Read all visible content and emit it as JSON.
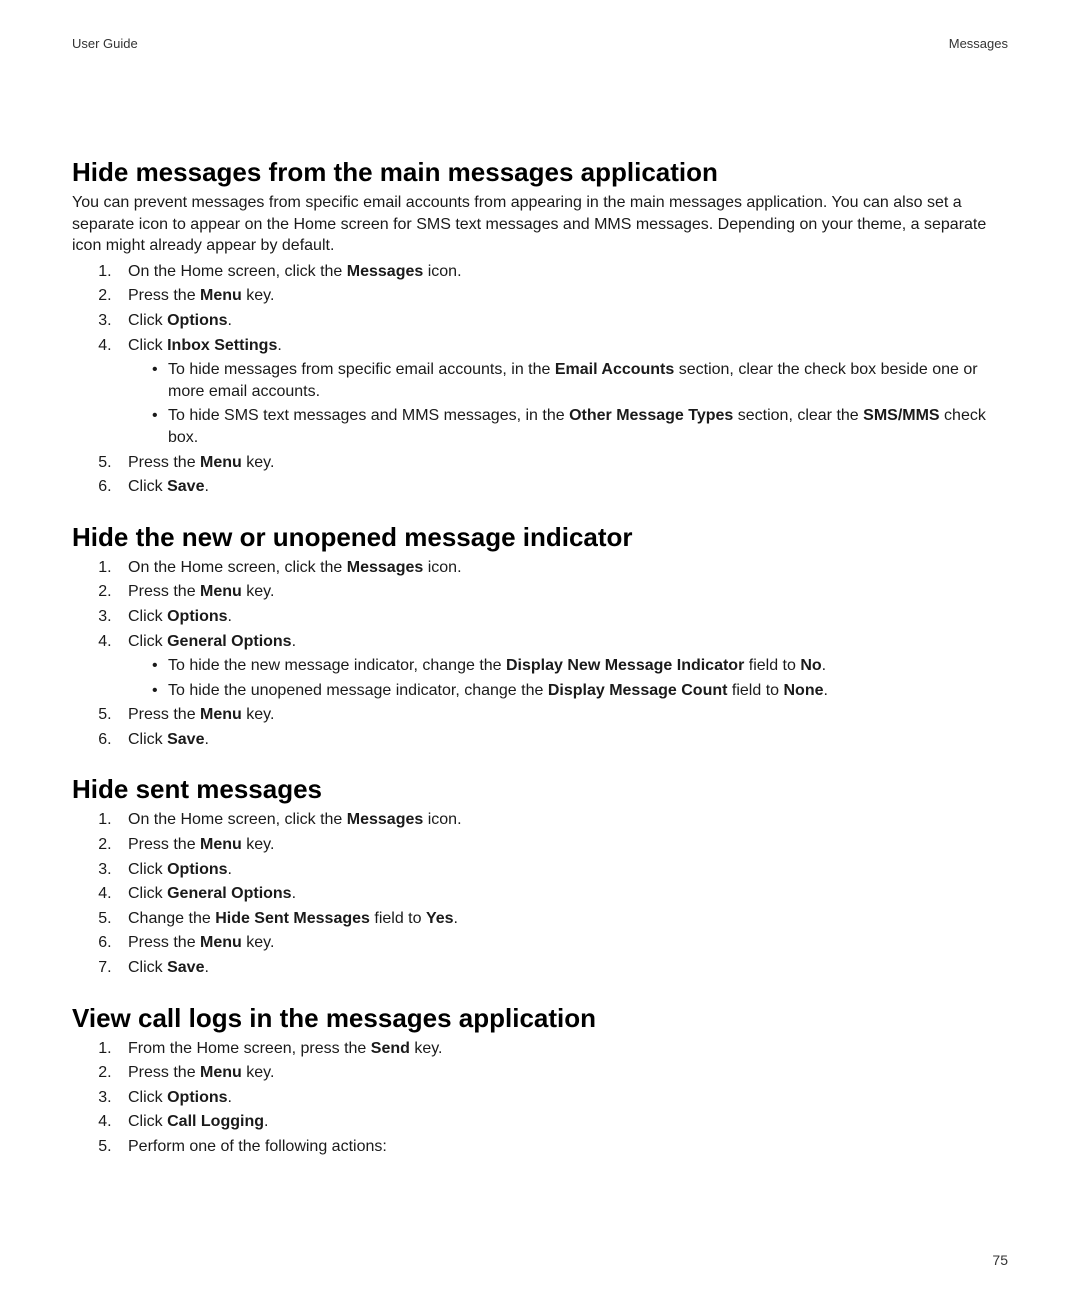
{
  "header": {
    "left": "User Guide",
    "right": "Messages"
  },
  "page_number": "75",
  "sections": [
    {
      "title": "Hide messages from the main messages application",
      "intro": "You can prevent messages from specific email accounts from appearing in the main messages application. You can also set a separate icon to appear on the Home screen for SMS text messages and MMS messages. Depending on your theme, a separate icon might already appear by default.",
      "steps": [
        {
          "pre": "On the Home screen, click the ",
          "bold": "Messages",
          "post": " icon."
        },
        {
          "pre": "Press the ",
          "bold": "Menu",
          "post": " key."
        },
        {
          "pre": "Click ",
          "bold": "Options",
          "post": "."
        },
        {
          "pre": "Click ",
          "bold": "Inbox Settings",
          "post": ".",
          "sub": [
            {
              "segments": [
                {
                  "t": "To hide messages from specific email accounts, in the "
                },
                {
                  "t": "Email Accounts",
                  "b": true
                },
                {
                  "t": " section, clear the check box beside one or more email accounts."
                }
              ]
            },
            {
              "segments": [
                {
                  "t": "To hide SMS text messages and MMS messages, in the "
                },
                {
                  "t": "Other Message Types",
                  "b": true
                },
                {
                  "t": " section, clear the "
                },
                {
                  "t": "SMS/MMS",
                  "b": true
                },
                {
                  "t": " check box."
                }
              ]
            }
          ]
        },
        {
          "pre": "Press the ",
          "bold": "Menu",
          "post": " key."
        },
        {
          "pre": "Click ",
          "bold": "Save",
          "post": "."
        }
      ]
    },
    {
      "title": "Hide the new or unopened message indicator",
      "steps": [
        {
          "pre": "On the Home screen, click the ",
          "bold": "Messages",
          "post": " icon."
        },
        {
          "pre": "Press the ",
          "bold": "Menu",
          "post": " key."
        },
        {
          "pre": "Click ",
          "bold": "Options",
          "post": "."
        },
        {
          "pre": "Click ",
          "bold": "General Options",
          "post": ".",
          "sub": [
            {
              "segments": [
                {
                  "t": "To hide the new message indicator, change the "
                },
                {
                  "t": "Display New Message Indicator",
                  "b": true
                },
                {
                  "t": " field to "
                },
                {
                  "t": "No",
                  "b": true
                },
                {
                  "t": "."
                }
              ]
            },
            {
              "segments": [
                {
                  "t": "To hide the unopened message indicator, change the "
                },
                {
                  "t": "Display Message Count",
                  "b": true
                },
                {
                  "t": " field to "
                },
                {
                  "t": "None",
                  "b": true
                },
                {
                  "t": "."
                }
              ]
            }
          ]
        },
        {
          "pre": "Press the ",
          "bold": "Menu",
          "post": " key."
        },
        {
          "pre": "Click ",
          "bold": "Save",
          "post": "."
        }
      ]
    },
    {
      "title": "Hide sent messages",
      "steps": [
        {
          "pre": "On the Home screen, click the ",
          "bold": "Messages",
          "post": " icon."
        },
        {
          "pre": "Press the ",
          "bold": "Menu",
          "post": " key."
        },
        {
          "pre": "Click ",
          "bold": "Options",
          "post": "."
        },
        {
          "pre": "Click ",
          "bold": "General Options",
          "post": "."
        },
        {
          "segments": [
            {
              "t": "Change the "
            },
            {
              "t": "Hide Sent Messages",
              "b": true
            },
            {
              "t": " field to "
            },
            {
              "t": "Yes",
              "b": true
            },
            {
              "t": "."
            }
          ]
        },
        {
          "pre": "Press the ",
          "bold": "Menu",
          "post": " key."
        },
        {
          "pre": "Click ",
          "bold": "Save",
          "post": "."
        }
      ]
    },
    {
      "title": "View call logs in the messages application",
      "steps": [
        {
          "pre": "From the Home screen, press the ",
          "bold": "Send",
          "post": " key."
        },
        {
          "pre": "Press the ",
          "bold": "Menu",
          "post": " key."
        },
        {
          "pre": "Click ",
          "bold": "Options",
          "post": "."
        },
        {
          "pre": "Click ",
          "bold": "Call Logging",
          "post": "."
        },
        {
          "pre": "Perform one of the following actions:",
          "bold": "",
          "post": ""
        }
      ]
    }
  ]
}
